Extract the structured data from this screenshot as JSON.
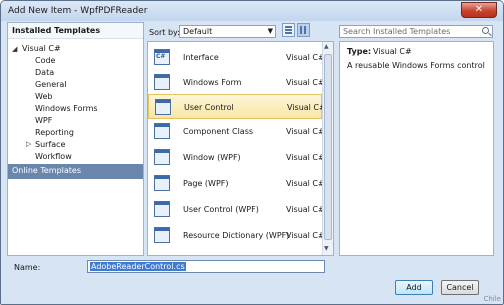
{
  "window": {
    "title": "Add New Item - WpfPDFReader",
    "close_glyph": "✕"
  },
  "left_pane": {
    "header": "Installed Templates",
    "tree": [
      {
        "label": "Visual C#",
        "expanded": true
      },
      {
        "label": "Code"
      },
      {
        "label": "Data"
      },
      {
        "label": "General"
      },
      {
        "label": "Web"
      },
      {
        "label": "Windows Forms"
      },
      {
        "label": "WPF"
      },
      {
        "label": "Reporting"
      },
      {
        "label": "Surface",
        "collapsed": true
      },
      {
        "label": "Workflow"
      }
    ],
    "online": "Online Templates"
  },
  "toolbar": {
    "sort_label": "Sort by:",
    "sort_value": "Default",
    "search_placeholder": "Search Installed Templates"
  },
  "templates": [
    {
      "name": "Interface",
      "lang": "Visual C#",
      "icon": "interface-icon",
      "icon_text": "C#"
    },
    {
      "name": "Windows Form",
      "lang": "Visual C#",
      "icon": "windows-form-icon",
      "icon_text": ""
    },
    {
      "name": "User Control",
      "lang": "Visual C#",
      "icon": "user-control-icon",
      "icon_text": "",
      "selected": true
    },
    {
      "name": "Component Class",
      "lang": "Visual C#",
      "icon": "component-class-icon",
      "icon_text": ""
    },
    {
      "name": "Window (WPF)",
      "lang": "Visual C#",
      "icon": "wpf-window-icon",
      "icon_text": ""
    },
    {
      "name": "Page (WPF)",
      "lang": "Visual C#",
      "icon": "wpf-page-icon",
      "icon_text": ""
    },
    {
      "name": "User Control (WPF)",
      "lang": "Visual C#",
      "icon": "wpf-user-control-icon",
      "icon_text": ""
    },
    {
      "name": "Resource Dictionary (WPF)",
      "lang": "Visual C#",
      "icon": "resource-dictionary-icon",
      "icon_text": ""
    }
  ],
  "details": {
    "type_label": "Type:",
    "type_value": "Visual C#",
    "description": "A reusable Windows Forms control"
  },
  "name_field": {
    "label": "Name:",
    "value": "AdobeReaderControl.cs"
  },
  "buttons": {
    "add": "Add",
    "cancel": "Cancel"
  },
  "watermark": "Chile"
}
